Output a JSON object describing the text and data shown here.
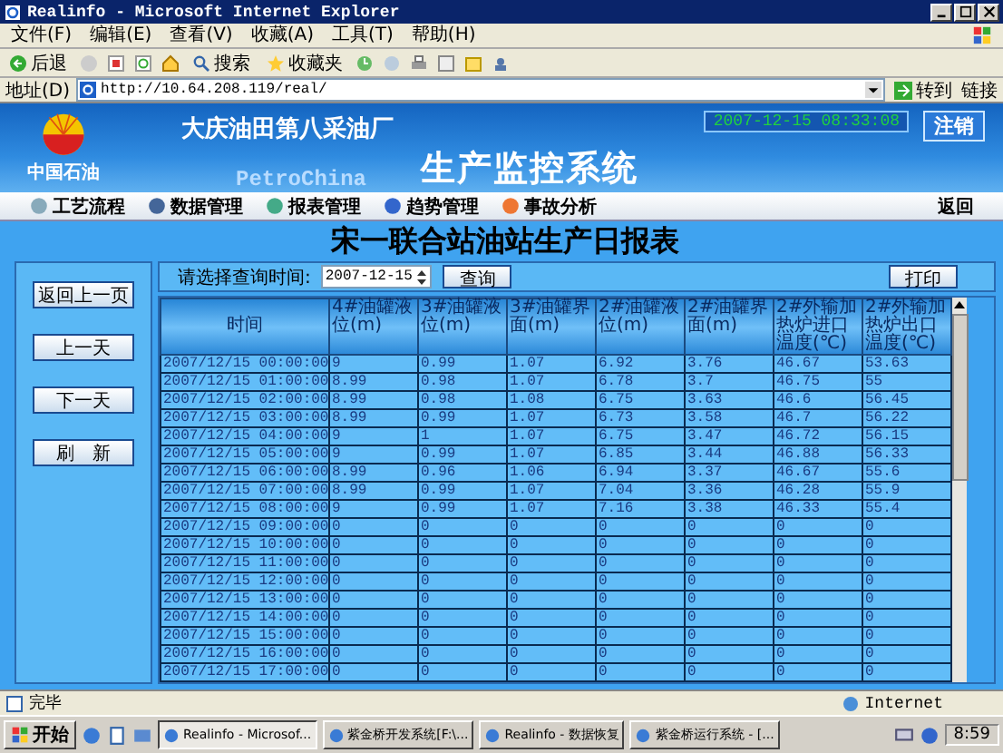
{
  "window": {
    "title": "Realinfo - Microsoft Internet Explorer"
  },
  "menu": [
    "文件(F)",
    "编辑(E)",
    "查看(V)",
    "收藏(A)",
    "工具(T)",
    "帮助(H)"
  ],
  "toolbar": {
    "back": "后退",
    "search": "搜索",
    "favorites": "收藏夹"
  },
  "address": {
    "label": "地址(D)",
    "url": "http://10.64.208.119/real/",
    "go": "转到",
    "links": "链接"
  },
  "banner": {
    "logo_text": "中国石油",
    "company": "大庆油田第八采油厂",
    "brand": "PetroChina",
    "system": "生产监控系统",
    "datetime": "2007-12-15 08:33:08",
    "logout": "注销"
  },
  "nav": {
    "items": [
      "工艺流程",
      "数据管理",
      "报表管理",
      "趋势管理",
      "事故分析"
    ],
    "back": "返回"
  },
  "report": {
    "title": "宋一联合站油站生产日报表",
    "side_buttons": [
      "返回上一页",
      "上一天",
      "下一天",
      "刷　新"
    ],
    "query": {
      "label": "请选择查询时间:",
      "date": "2007-12-15",
      "search": "查询",
      "print": "打印"
    },
    "columns": [
      "时间",
      "4#油罐液位(m)",
      "3#油罐液位(m)",
      "3#油罐界面(m)",
      "2#油罐液位(m)",
      "2#油罐界面(m)",
      "2#外输加热炉进口温度(℃)",
      "2#外输加热炉出口温度(℃)"
    ],
    "rows": [
      [
        "2007/12/15 00:00:00",
        "9",
        "0.99",
        "1.07",
        "6.92",
        "3.76",
        "46.67",
        "53.63"
      ],
      [
        "2007/12/15 01:00:00",
        "8.99",
        "0.98",
        "1.07",
        "6.78",
        "3.7",
        "46.75",
        "55"
      ],
      [
        "2007/12/15 02:00:00",
        "8.99",
        "0.98",
        "1.08",
        "6.75",
        "3.63",
        "46.6",
        "56.45"
      ],
      [
        "2007/12/15 03:00:00",
        "8.99",
        "0.99",
        "1.07",
        "6.73",
        "3.58",
        "46.7",
        "56.22"
      ],
      [
        "2007/12/15 04:00:00",
        "9",
        "1",
        "1.07",
        "6.75",
        "3.47",
        "46.72",
        "56.15"
      ],
      [
        "2007/12/15 05:00:00",
        "9",
        "0.99",
        "1.07",
        "6.85",
        "3.44",
        "46.88",
        "56.33"
      ],
      [
        "2007/12/15 06:00:00",
        "8.99",
        "0.96",
        "1.06",
        "6.94",
        "3.37",
        "46.67",
        "55.6"
      ],
      [
        "2007/12/15 07:00:00",
        "8.99",
        "0.99",
        "1.07",
        "7.04",
        "3.36",
        "46.28",
        "55.9"
      ],
      [
        "2007/12/15 08:00:00",
        "9",
        "0.99",
        "1.07",
        "7.16",
        "3.38",
        "46.33",
        "55.4"
      ],
      [
        "2007/12/15 09:00:00",
        "0",
        "0",
        "0",
        "0",
        "0",
        "0",
        "0"
      ],
      [
        "2007/12/15 10:00:00",
        "0",
        "0",
        "0",
        "0",
        "0",
        "0",
        "0"
      ],
      [
        "2007/12/15 11:00:00",
        "0",
        "0",
        "0",
        "0",
        "0",
        "0",
        "0"
      ],
      [
        "2007/12/15 12:00:00",
        "0",
        "0",
        "0",
        "0",
        "0",
        "0",
        "0"
      ],
      [
        "2007/12/15 13:00:00",
        "0",
        "0",
        "0",
        "0",
        "0",
        "0",
        "0"
      ],
      [
        "2007/12/15 14:00:00",
        "0",
        "0",
        "0",
        "0",
        "0",
        "0",
        "0"
      ],
      [
        "2007/12/15 15:00:00",
        "0",
        "0",
        "0",
        "0",
        "0",
        "0",
        "0"
      ],
      [
        "2007/12/15 16:00:00",
        "0",
        "0",
        "0",
        "0",
        "0",
        "0",
        "0"
      ],
      [
        "2007/12/15 17:00:00",
        "0",
        "0",
        "0",
        "0",
        "0",
        "0",
        "0"
      ]
    ]
  },
  "status_bar": {
    "text": "完毕",
    "zone": "Internet"
  },
  "taskbar": {
    "start": "开始",
    "tasks": [
      {
        "label": "Realinfo - Microsof...",
        "selected": true
      },
      {
        "label": "紫金桥开发系统[F:\\...",
        "selected": false
      },
      {
        "label": "Realinfo - 数据恢复",
        "selected": false
      },
      {
        "label": "紫金桥运行系统 - [...",
        "selected": false
      }
    ],
    "clock": "8:59"
  }
}
